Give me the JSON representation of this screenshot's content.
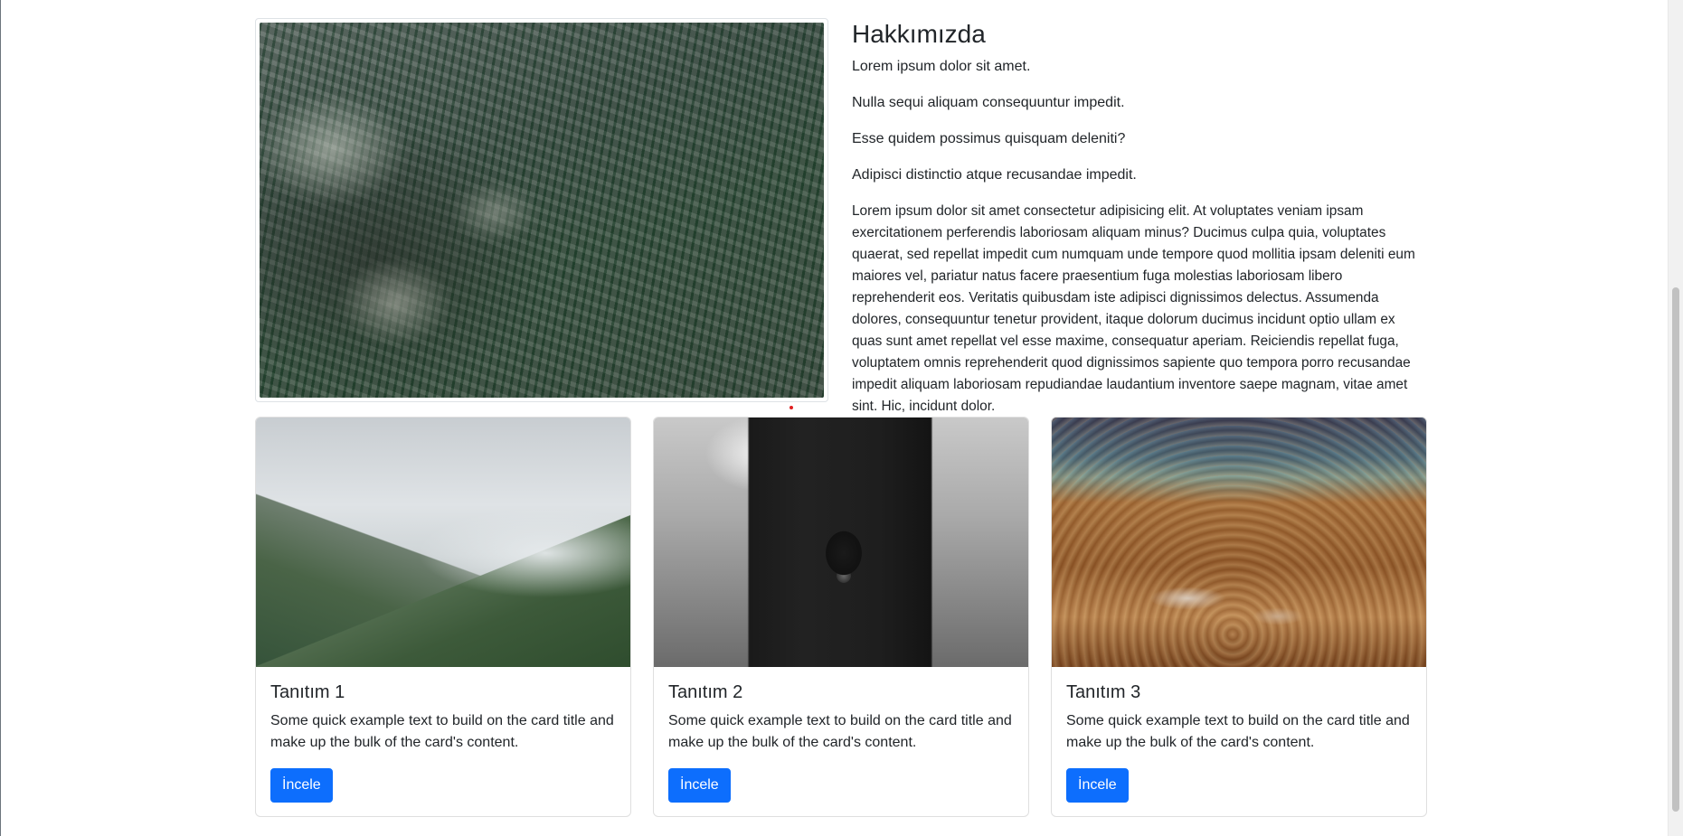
{
  "about": {
    "title": "Hakkımızda",
    "paragraphs": [
      "Lorem ipsum dolor sit amet.",
      "Nulla sequi aliquam consequuntur impedit.",
      "Esse quidem possimus quisquam deleniti?",
      "Adipisci distinctio atque recusandae impedit."
    ],
    "long_paragraph": "Lorem ipsum dolor sit amet consectetur adipisicing elit. At voluptates veniam ipsam exercitationem perferendis laboriosam aliquam minus? Ducimus culpa quia, voluptates quaerat, sed repellat impedit cum numquam unde tempore quod mollitia ipsam deleniti eum maiores vel, pariatur natus facere praesentium fuga molestias laboriosam libero reprehenderit eos. Veritatis quibusdam iste adipisci dignissimos delectus. Assumenda dolores, consequuntur tenetur provident, itaque dolorum ducimus incidunt optio ullam ex quas sunt amet repellat vel esse maxime, consequatur aperiam. Reiciendis repellat fuga, voluptatem omnis reprehenderit quod dignissimos sapiente quo tempora porro recusandae impedit aliquam laboriosam repudiandae laudantium inventore saepe magnam, vitae amet sint. Hic, incidunt dolor."
  },
  "cards": [
    {
      "title": "Tanıtım 1",
      "text": "Some quick example text to build on the card title and make up the bulk of the card's content.",
      "button": "İncele"
    },
    {
      "title": "Tanıtım 2",
      "text": "Some quick example text to build on the card title and make up the bulk of the card's content.",
      "button": "İncele"
    },
    {
      "title": "Tanıtım 3",
      "text": "Some quick example text to build on the card title and make up the bulk of the card's content.",
      "button": "İncele"
    }
  ],
  "colors": {
    "primary_button": "#0d6efd",
    "text": "#212529",
    "border": "#dee2e6"
  }
}
